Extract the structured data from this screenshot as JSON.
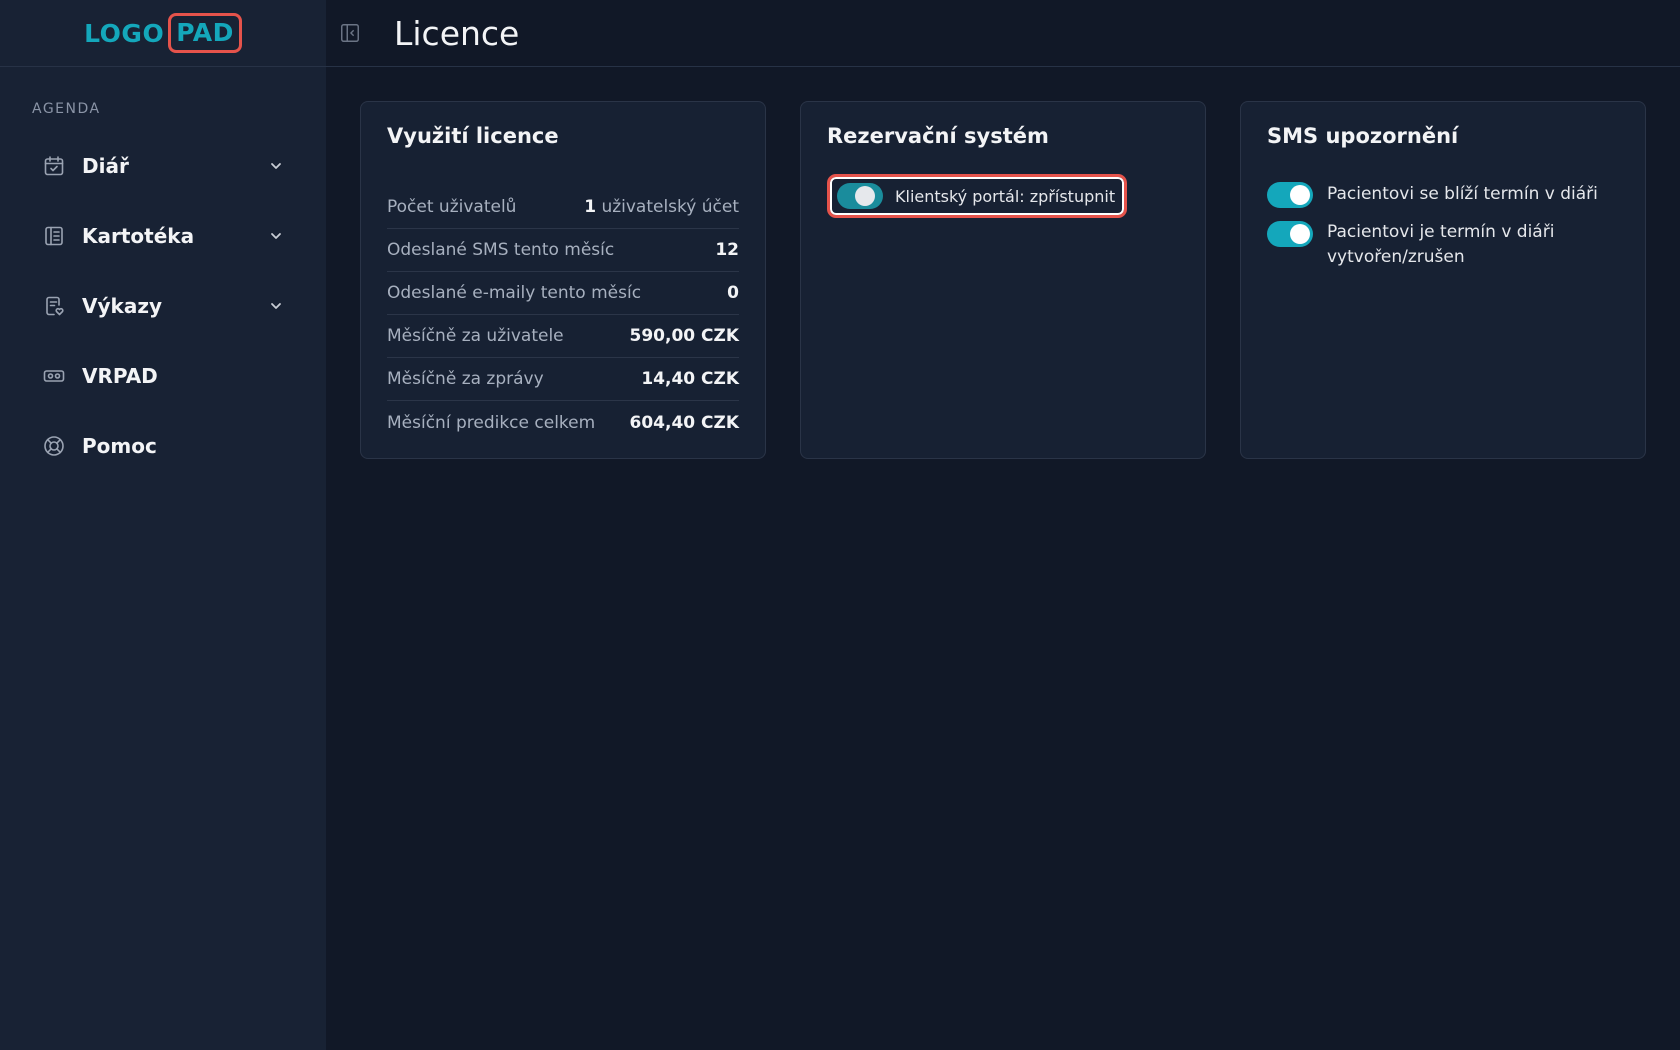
{
  "logo": {
    "part1": "LOGO",
    "part2": "PAD"
  },
  "sidebar": {
    "section_label": "AGENDA",
    "items": [
      {
        "label": "Diář",
        "icon": "calendar-check-icon",
        "has_chevron": true
      },
      {
        "label": "Kartotéka",
        "icon": "notebook-icon",
        "has_chevron": true
      },
      {
        "label": "Výkazy",
        "icon": "report-icon",
        "has_chevron": true
      },
      {
        "label": "VRPAD",
        "icon": "vr-headset-icon",
        "has_chevron": false
      },
      {
        "label": "Pomoc",
        "icon": "lifebuoy-icon",
        "has_chevron": false
      }
    ]
  },
  "header": {
    "title": "Licence"
  },
  "cards": {
    "license": {
      "title": "Využití licence",
      "rows": [
        {
          "label": "Počet uživatelů",
          "value": "1",
          "unit": "uživatelský účet"
        },
        {
          "label": "Odeslané SMS tento měsíc",
          "value": "12",
          "unit": ""
        },
        {
          "label": "Odeslané e-maily tento měsíc",
          "value": "0",
          "unit": ""
        },
        {
          "label": "Měsíčně za uživatele",
          "value": "590,00 CZK",
          "unit": ""
        },
        {
          "label": "Měsíčně za zprávy",
          "value": "14,40 CZK",
          "unit": ""
        },
        {
          "label": "Měsíční predikce celkem",
          "value": "604,40 CZK",
          "unit": ""
        }
      ]
    },
    "booking": {
      "title": "Rezervační systém",
      "toggle_label": "Klientský portál: zpřístupnit",
      "toggle_on": true
    },
    "sms": {
      "title": "SMS upozornění",
      "toggles": [
        {
          "label": "Pacientovi se blíží termín v diáři",
          "on": true
        },
        {
          "label": "Pacientovi je termín v diáři vytvořen/zrušen",
          "on": true
        }
      ]
    }
  },
  "colors": {
    "accent": "#14a7bb",
    "highlight": "#e5534b",
    "background": "#111827",
    "sidebar": "#182234"
  }
}
